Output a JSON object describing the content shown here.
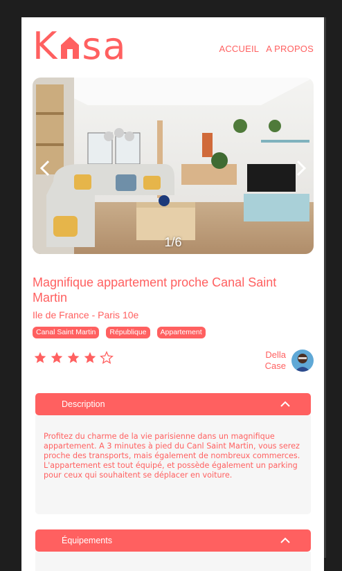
{
  "header": {
    "logo_text_left": "K",
    "logo_text_right": "sa",
    "nav": [
      "ACCUEIL",
      "A PROPOS"
    ]
  },
  "carousel": {
    "counter": "1/6",
    "prev_icon": "chevron-left-icon",
    "next_icon": "chevron-right-icon"
  },
  "listing": {
    "title": "Magnifique appartement proche Canal Saint Martin",
    "location": "Ile de France - Paris 10e",
    "tags": [
      "Canal Saint Martin",
      "République",
      "Appartement"
    ],
    "rating": 4,
    "rating_max": 5
  },
  "host": {
    "first_name": "Della",
    "last_name": "Case"
  },
  "sections": [
    {
      "label": "Description",
      "text": "Profitez du charme de la vie parisienne dans un magnifique appartement. A 3 minutes à pied du Canl Saint Martin, vous serez proche des transports, mais également de nombreux commerces. L'appartement est tout équipé, et possède également un parking pour ceux qui souhaitent se déplacer en voiture."
    },
    {
      "label": "Équipements"
    }
  ],
  "colors": {
    "accent": "#FF6060",
    "panel": "#F6F6F6",
    "background": "#1e1e1e"
  }
}
